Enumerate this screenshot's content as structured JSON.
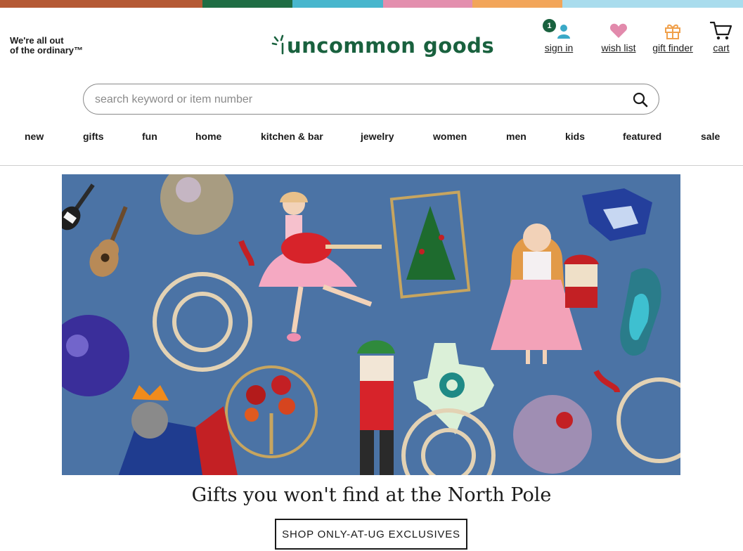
{
  "brand": {
    "tagline_line1": "We're all out",
    "tagline_line2": "of the ordinary™",
    "logo_text": "uncommon goods",
    "logo_color": "#19613e"
  },
  "stripe_colors": [
    "#b55a35",
    "#b55a35",
    "#1f6d44",
    "#48b6cd",
    "#e38fae",
    "#f2a559",
    "#a9dced",
    "#a9dced"
  ],
  "header_links": {
    "sign_in": {
      "label": "sign in",
      "icon": "person-icon",
      "badge": "1"
    },
    "wish_list": {
      "label": "wish list",
      "icon": "heart-icon"
    },
    "gift_finder": {
      "label": "gift finder",
      "icon": "gift-icon"
    },
    "cart": {
      "label": "cart",
      "icon": "cart-icon"
    }
  },
  "search": {
    "placeholder": "search keyword or item number",
    "value": "",
    "icon": "search-icon"
  },
  "nav": {
    "items": [
      "new",
      "gifts",
      "fun",
      "home",
      "kitchen & bar",
      "jewelry",
      "women",
      "men",
      "kids",
      "featured",
      "sale"
    ]
  },
  "hero": {
    "headline": "Gifts you won't find at the North Pole",
    "cta_label": "SHOP ONLY-AT-UG EXCLUSIVES",
    "background": "#4b73a5"
  }
}
